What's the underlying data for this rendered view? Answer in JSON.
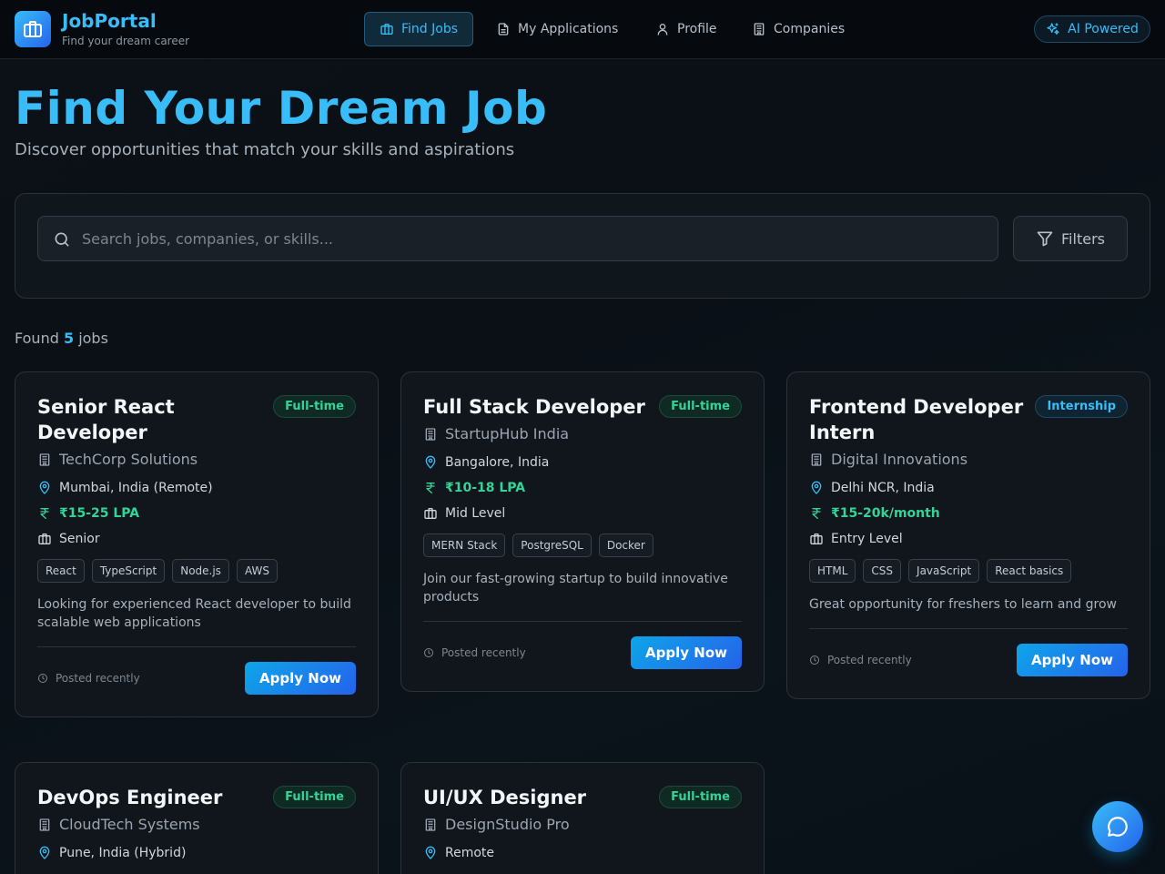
{
  "brand": {
    "name": "JobPortal",
    "tagline": "Find your dream career"
  },
  "nav": [
    {
      "label": "Find Jobs",
      "icon": "briefcase-icon",
      "active": true
    },
    {
      "label": "My Applications",
      "icon": "document-icon",
      "active": false
    },
    {
      "label": "Profile",
      "icon": "user-icon",
      "active": false
    },
    {
      "label": "Companies",
      "icon": "building-icon",
      "active": false
    }
  ],
  "ai_badge": "AI Powered",
  "hero": {
    "title": "Find Your Dream Job",
    "subtitle": "Discover opportunities that match your skills and aspirations"
  },
  "search": {
    "placeholder": "Search jobs, companies, or skills...",
    "value": "",
    "filters_label": "Filters"
  },
  "results": {
    "prefix": "Found",
    "count": "5",
    "suffix": "jobs"
  },
  "jobs": [
    {
      "title": "Senior React Developer",
      "type": "Full-time",
      "company": "TechCorp Solutions",
      "location": "Mumbai, India (Remote)",
      "salary": "₹15-25 LPA",
      "level": "Senior",
      "skills": [
        "React",
        "TypeScript",
        "Node.js",
        "AWS"
      ],
      "description": "Looking for experienced React developer to build scalable web applications",
      "posted": "Posted recently",
      "apply_label": "Apply Now"
    },
    {
      "title": "Full Stack Developer",
      "type": "Full-time",
      "company": "StartupHub India",
      "location": "Bangalore, India",
      "salary": "₹10-18 LPA",
      "level": "Mid Level",
      "skills": [
        "MERN Stack",
        "PostgreSQL",
        "Docker"
      ],
      "description": "Join our fast-growing startup to build innovative products",
      "posted": "Posted recently",
      "apply_label": "Apply Now"
    },
    {
      "title": "Frontend Developer Intern",
      "type": "Internship",
      "company": "Digital Innovations",
      "location": "Delhi NCR, India",
      "salary": "₹15-20k/month",
      "level": "Entry Level",
      "skills": [
        "HTML",
        "CSS",
        "JavaScript",
        "React basics"
      ],
      "description": "Great opportunity for freshers to learn and grow",
      "posted": "Posted recently",
      "apply_label": "Apply Now"
    },
    {
      "title": "DevOps Engineer",
      "type": "Full-time",
      "company": "CloudTech Systems",
      "location": "Pune, India (Hybrid)"
    },
    {
      "title": "UI/UX Designer",
      "type": "Full-time",
      "company": "DesignStudio Pro",
      "location": "Remote"
    }
  ],
  "colors": {
    "accent": "#38bdf8",
    "salary": "#34d399",
    "background": "#0b1117"
  }
}
